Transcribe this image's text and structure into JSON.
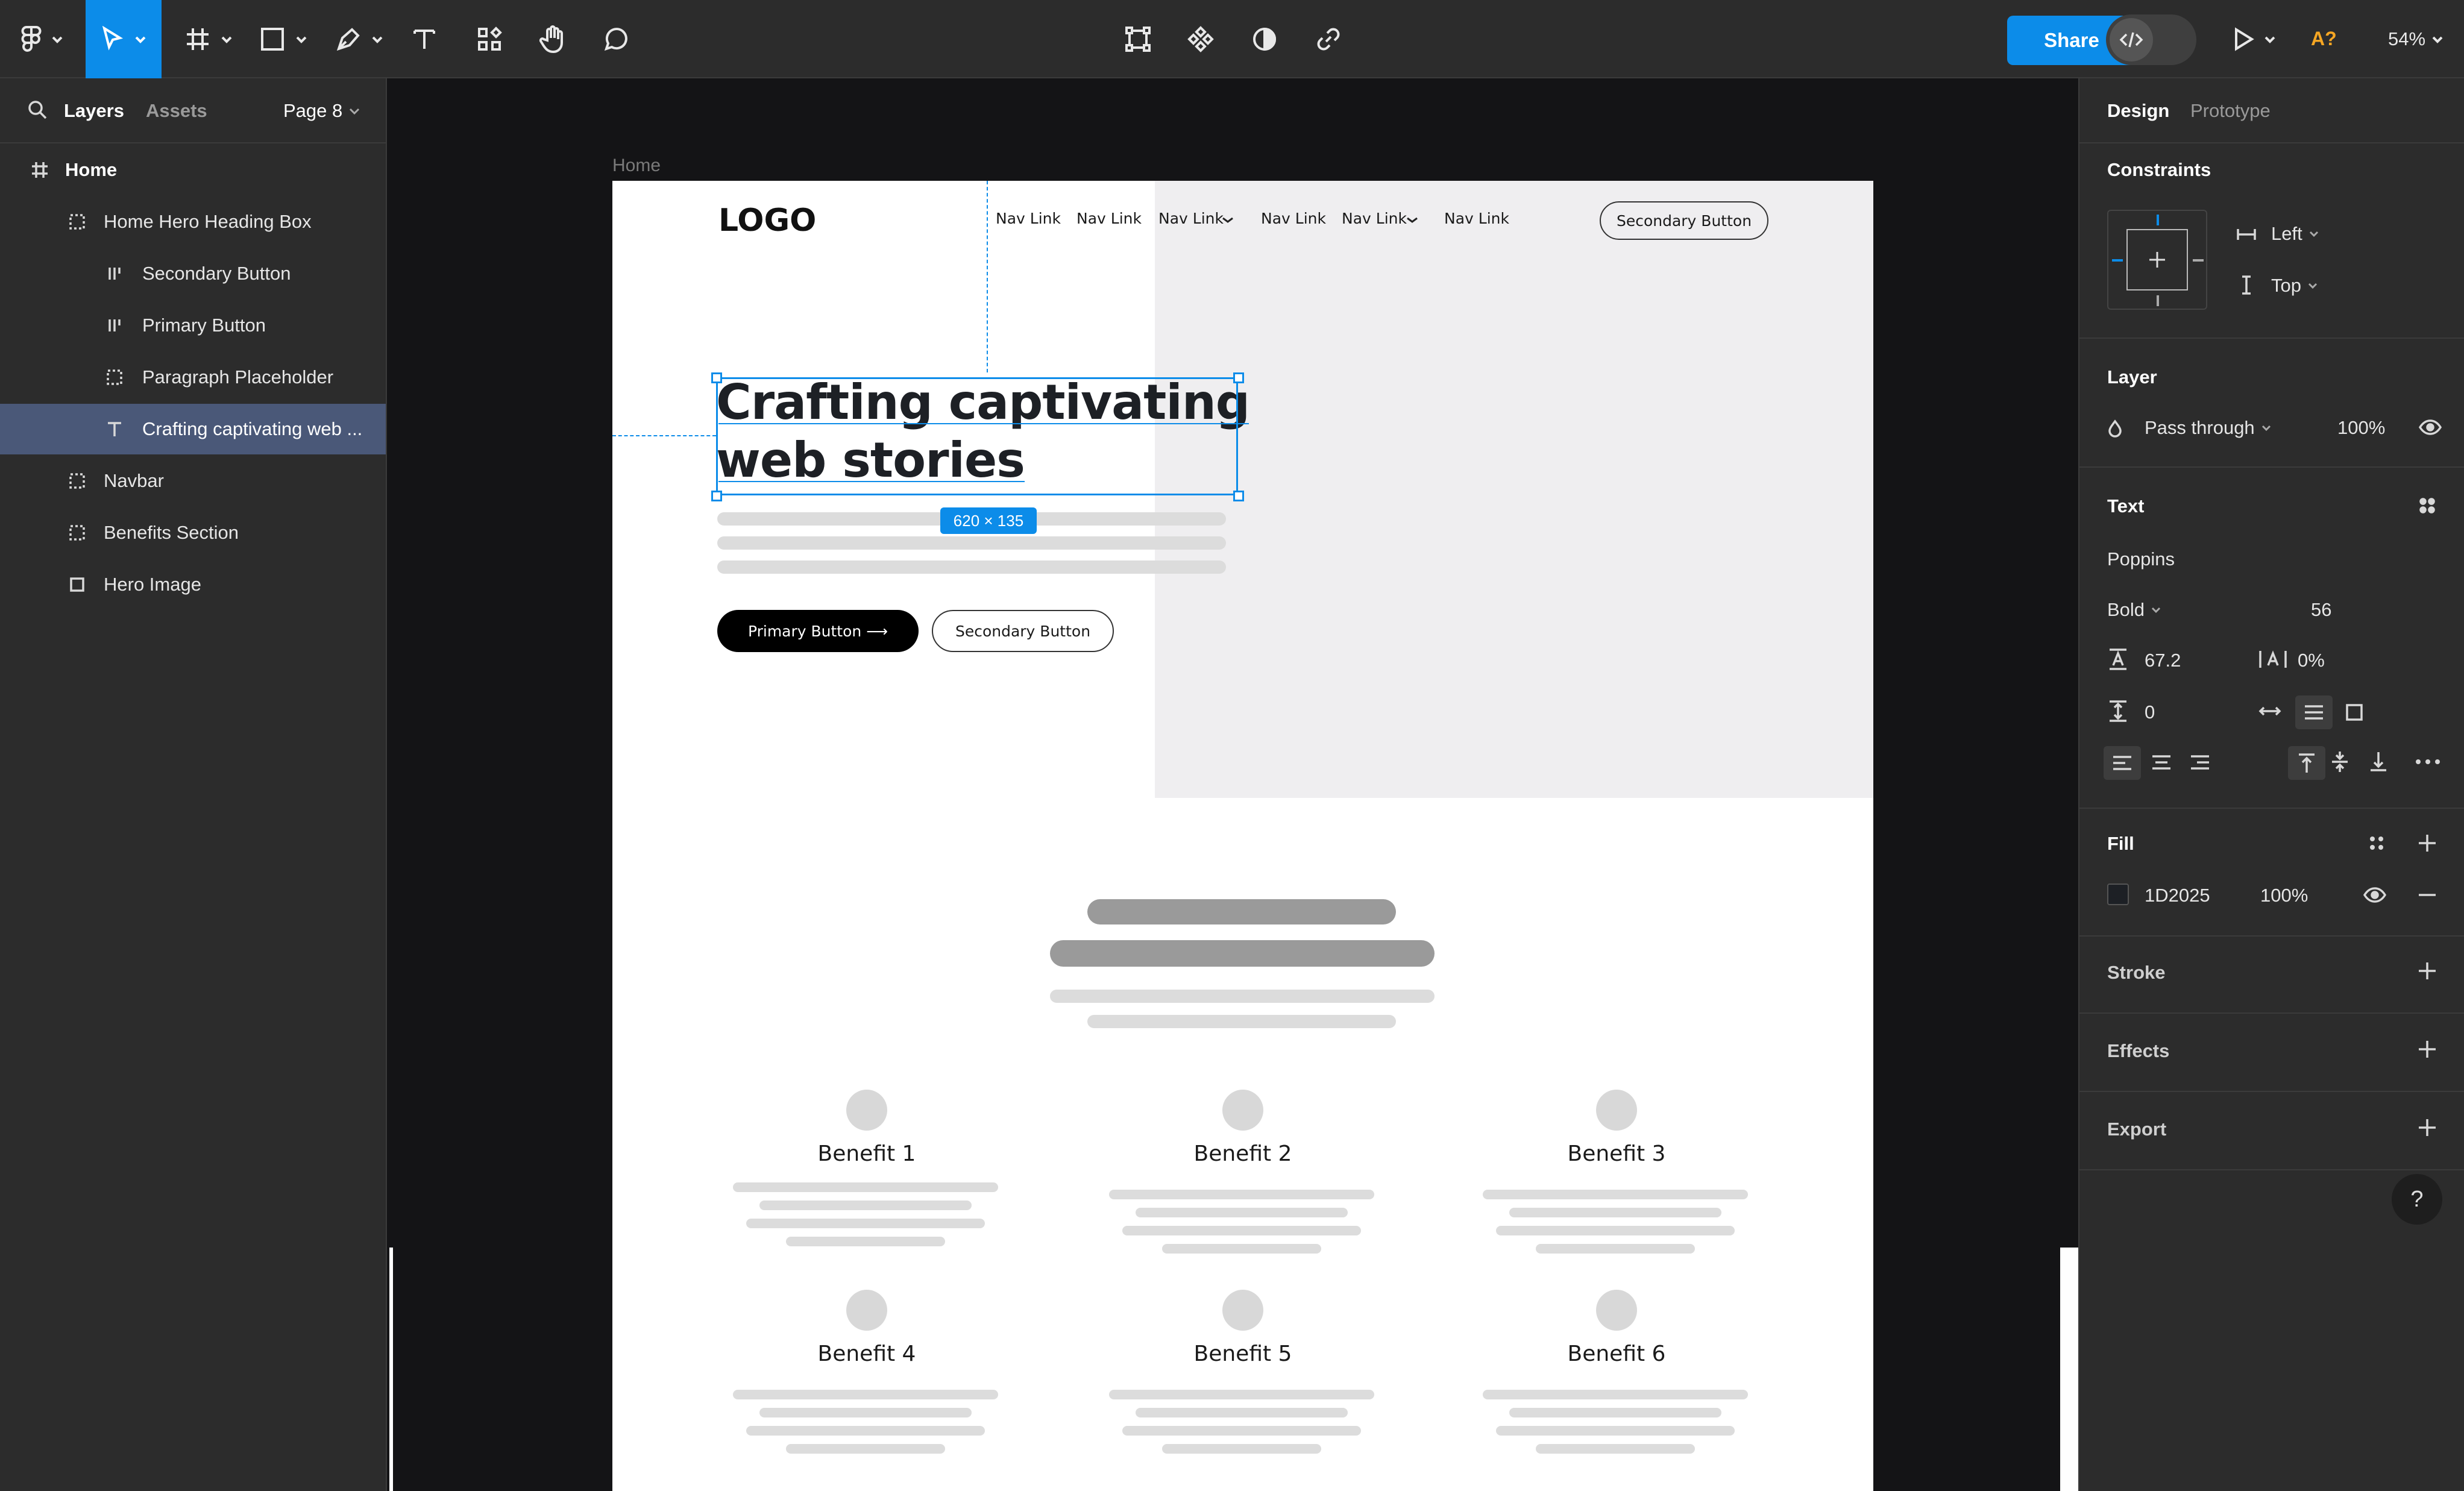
{
  "toolbar": {
    "share_label": "Share",
    "font_warning": "A?",
    "zoom": "54%",
    "tools": [
      "main-menu",
      "move",
      "frame",
      "shape",
      "pen",
      "text",
      "resources",
      "hand",
      "comment"
    ],
    "center_tools": [
      "edit-object",
      "component",
      "mask",
      "link"
    ]
  },
  "left_panel": {
    "tabs": {
      "layers": "Layers",
      "assets": "Assets"
    },
    "page": "Page 8",
    "layers": [
      {
        "label": "Home",
        "type": "frame"
      },
      {
        "label": "Home Hero Heading Box",
        "type": "group"
      },
      {
        "label": "Secondary Button",
        "type": "autolayout"
      },
      {
        "label": "Primary Button",
        "type": "autolayout"
      },
      {
        "label": "Paragraph Placeholder",
        "type": "group"
      },
      {
        "label": "Crafting captivating web ...",
        "type": "text",
        "selected": true
      },
      {
        "label": "Navbar",
        "type": "group"
      },
      {
        "label": "Benefits Section",
        "type": "group"
      },
      {
        "label": "Hero Image",
        "type": "rectangle"
      }
    ]
  },
  "canvas": {
    "frame_label": "Home",
    "logo": "LOGO",
    "nav_links": [
      "Nav Link",
      "Nav Link",
      "Nav Link",
      "Nav Link",
      "Nav Link",
      "Nav Link"
    ],
    "nav_button": "Secondary Button",
    "heading_line1": "Crafting captivating",
    "heading_line2": "web stories",
    "size_badge": "620 × 135",
    "primary_button": "Primary Button ⟶",
    "secondary_button": "Secondary Button",
    "benefits": [
      "Benefit 1",
      "Benefit 2",
      "Benefit 3",
      "Benefit 4",
      "Benefit 5",
      "Benefit 6"
    ]
  },
  "right_panel": {
    "tabs": {
      "design": "Design",
      "prototype": "Prototype"
    },
    "constraints": {
      "title": "Constraints",
      "horizontal": "Left",
      "vertical": "Top"
    },
    "layer": {
      "title": "Layer",
      "blend": "Pass through",
      "opacity": "100%"
    },
    "text": {
      "title": "Text",
      "font": "Poppins",
      "weight": "Bold",
      "size": "56",
      "line_height": "67.2",
      "letter_spacing": "0%",
      "paragraph_spacing": "0"
    },
    "fill": {
      "title": "Fill",
      "hex": "1D2025",
      "opacity": "100%",
      "swatch": "#1D2025"
    },
    "stroke": {
      "title": "Stroke"
    },
    "effects": {
      "title": "Effects"
    },
    "export": {
      "title": "Export"
    },
    "help": "?"
  },
  "colors": {
    "accent": "#0C8CE9",
    "panel": "#2C2C2C",
    "selected_layer": "#4A5878",
    "warning": "#F5A623"
  }
}
